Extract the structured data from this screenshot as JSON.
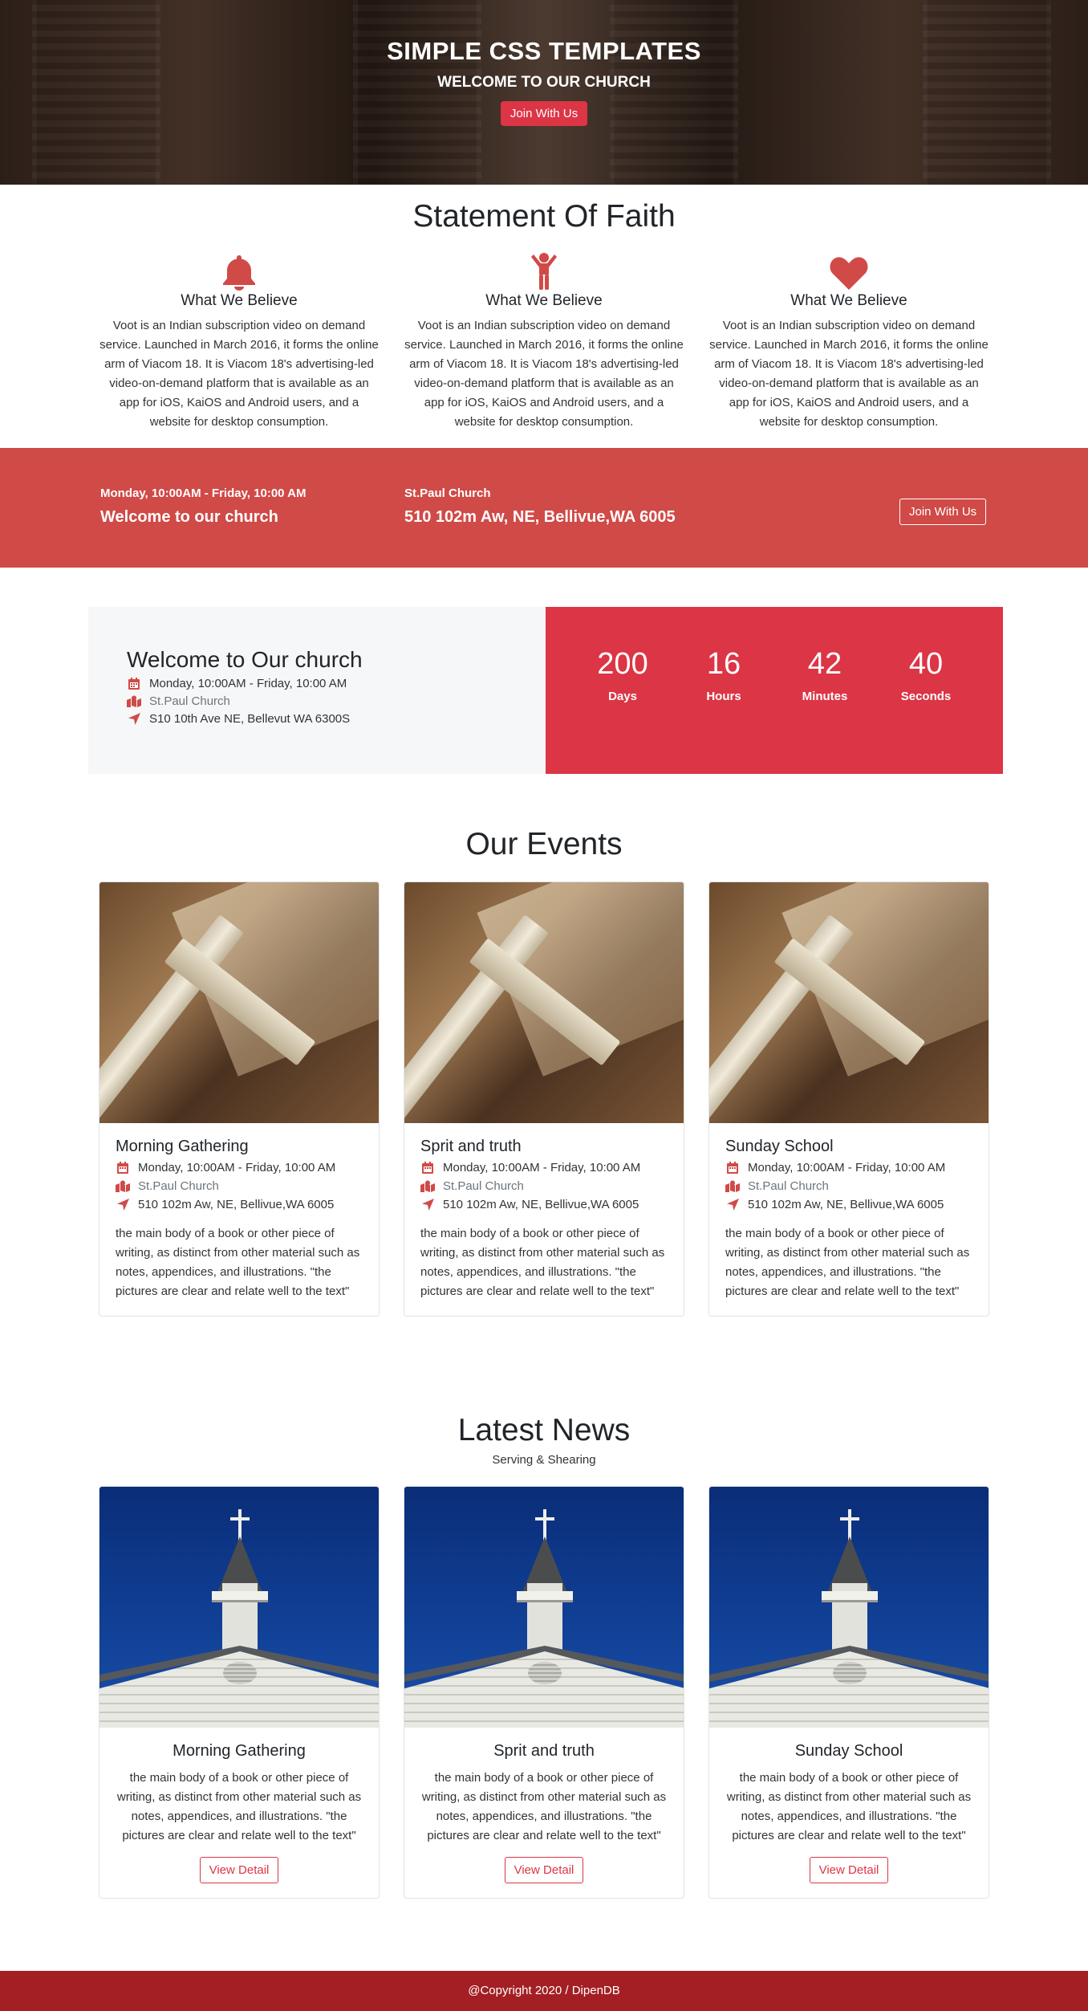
{
  "hero": {
    "title": "SIMPLE CSS TEMPLATES",
    "subtitle": "WELCOME TO OUR CHURCH",
    "button": "Join With Us"
  },
  "faith": {
    "title": "Statement Of Faith",
    "items": [
      {
        "icon": "bell-icon",
        "title": "What We Believe",
        "text": "Voot is an Indian subscription video on demand service. Launched in March 2016, it forms the online arm of Viacom 18. It is Viacom 18's advertising-led video-on-demand platform that is available as an app for iOS, KaiOS and Android users, and a website for desktop consumption."
      },
      {
        "icon": "child-icon",
        "title": "What We Believe",
        "text": "Voot is an Indian subscription video on demand service. Launched in March 2016, it forms the online arm of Viacom 18. It is Viacom 18's advertising-led video-on-demand platform that is available as an app for iOS, KaiOS and Android users, and a website for desktop consumption."
      },
      {
        "icon": "heart-icon",
        "title": "What We Believe",
        "text": "Voot is an Indian subscription video on demand service. Launched in March 2016, it forms the online arm of Viacom 18. It is Viacom 18's advertising-led video-on-demand platform that is available as an app for iOS, KaiOS and Android users, and a website for desktop consumption."
      }
    ]
  },
  "banner": {
    "time": "Monday, 10:00AM - Friday, 10:00 AM",
    "welcome": "Welcome to our church",
    "church": "St.Paul Church",
    "address": "510 102m Aw, NE, Bellivue,WA 6005",
    "button": "Join With Us"
  },
  "welcome": {
    "title": "Welcome to Our church",
    "time": "Monday, 10:00AM - Friday, 10:00 AM",
    "church": "St.Paul Church",
    "address": "S10 10th Ave NE, Bellevut WA 6300S"
  },
  "countdown": [
    {
      "value": "200",
      "label": "Days"
    },
    {
      "value": "16",
      "label": "Hours"
    },
    {
      "value": "42",
      "label": "Minutes"
    },
    {
      "value": "40",
      "label": "Seconds"
    }
  ],
  "events": {
    "title": "Our Events",
    "items": [
      {
        "title": "Morning Gathering",
        "time": "Monday, 10:00AM - Friday, 10:00 AM",
        "church": "St.Paul Church",
        "address": "510 102m Aw, NE, Bellivue,WA 6005",
        "text": "the main body of a book or other piece of writing, as distinct from other material such as notes, appendices, and illustrations. \"the pictures are clear and relate well to the text\""
      },
      {
        "title": "Sprit and truth",
        "time": "Monday, 10:00AM - Friday, 10:00 AM",
        "church": "St.Paul Church",
        "address": "510 102m Aw, NE, Bellivue,WA 6005",
        "text": "the main body of a book or other piece of writing, as distinct from other material such as notes, appendices, and illustrations. \"the pictures are clear and relate well to the text\""
      },
      {
        "title": "Sunday School",
        "time": "Monday, 10:00AM - Friday, 10:00 AM",
        "church": "St.Paul Church",
        "address": "510 102m Aw, NE, Bellivue,WA 6005",
        "text": "the main body of a book or other piece of writing, as distinct from other material such as notes, appendices, and illustrations. \"the pictures are clear and relate well to the text\""
      }
    ]
  },
  "news": {
    "title": "Latest News",
    "subtitle": "Serving & Shearing",
    "items": [
      {
        "title": "Morning Gathering",
        "text": "the main body of a book or other piece of writing, as distinct from other material such as notes, appendices, and illustrations. \"the pictures are clear and relate well to the text\"",
        "button": "View Detail"
      },
      {
        "title": "Sprit and truth",
        "text": "the main body of a book or other piece of writing, as distinct from other material such as notes, appendices, and illustrations. \"the pictures are clear and relate well to the text\"",
        "button": "View Detail"
      },
      {
        "title": "Sunday School",
        "text": "the main body of a book or other piece of writing, as distinct from other material such as notes, appendices, and illustrations. \"the pictures are clear and relate well to the text\"",
        "button": "View Detail"
      }
    ]
  },
  "footer": {
    "text": "@Copyright 2020 / DipenDB"
  },
  "colors": {
    "accent": "#dc3545",
    "banner": "#d04a47",
    "footer": "#a31f24"
  }
}
